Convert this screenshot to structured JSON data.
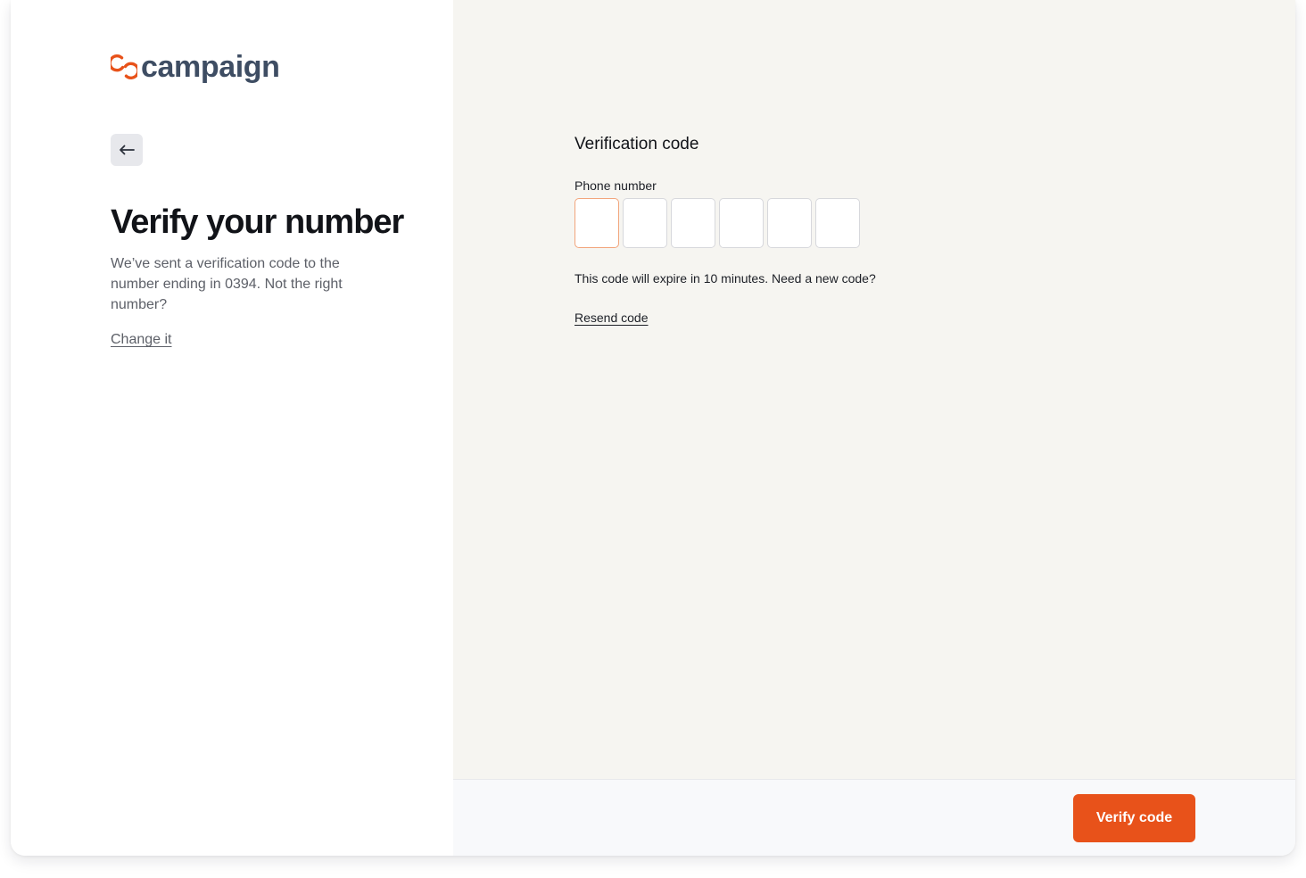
{
  "brand": {
    "name": "campaign",
    "accent_color": "#e8521a",
    "text_color": "#3e4d63"
  },
  "left": {
    "back_icon": "arrow-left-icon",
    "title": "Verify your number",
    "description": "We’ve sent a verification code to the number ending in 0394. Not the right number?",
    "change_link": "Change it"
  },
  "right": {
    "section_title": "Verification code",
    "field_label": "Phone number",
    "code_digits": [
      "",
      "",
      "",
      "",
      "",
      ""
    ],
    "expire_text": "This code will expire in 10 minutes. Need a new code?",
    "resend_link": "Resend code"
  },
  "footer": {
    "verify_button": "Verify code"
  }
}
